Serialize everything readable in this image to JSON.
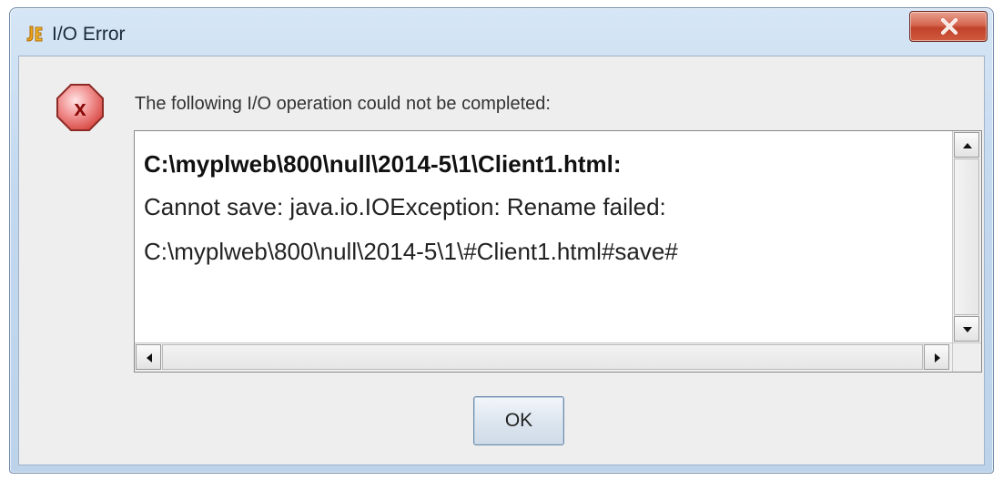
{
  "window": {
    "title": "I/O Error",
    "app_icon": "java-icon",
    "close_icon": "close-icon"
  },
  "dialog": {
    "icon": "error-icon",
    "message": "The following I/O operation could not be completed:",
    "details": {
      "line1": "C:\\myplweb\\800\\null\\2014-5\\1\\Client1.html:",
      "line2": "Cannot save: java.io.IOException: Rename failed:",
      "line3": "C:\\myplweb\\800\\null\\2014-5\\1\\#Client1.html#save#"
    },
    "ok_label": "OK"
  },
  "colors": {
    "error_red": "#c0141a",
    "title_bar": "#c3d8ee",
    "close_button": "#c1422b"
  }
}
